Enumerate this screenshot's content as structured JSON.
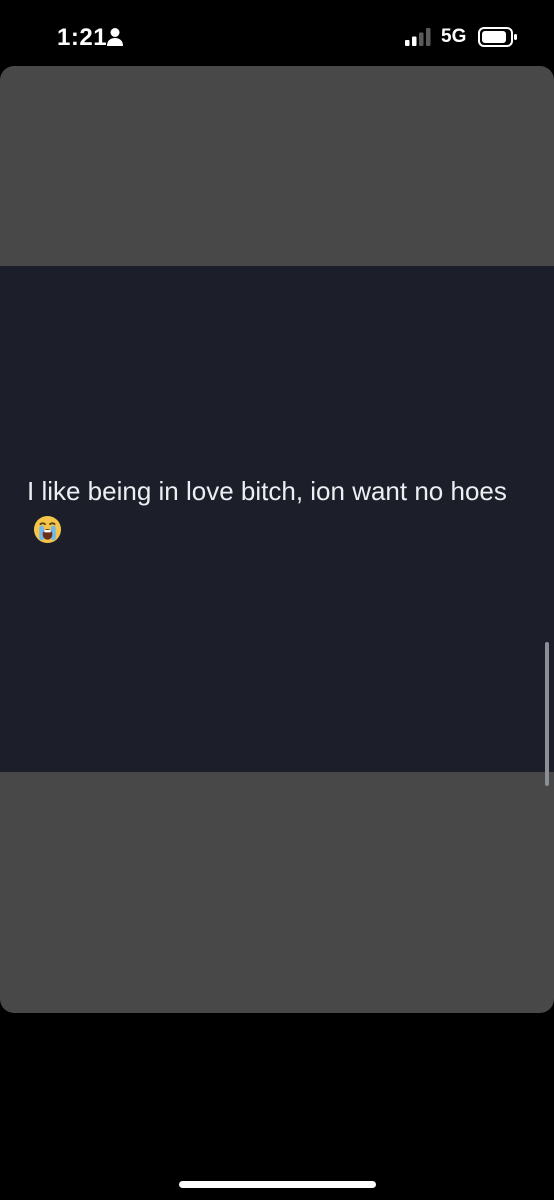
{
  "status_bar": {
    "time": "1:21",
    "network": "5G",
    "icons": {
      "person": "person-icon",
      "signal": "cellular-signal-icon",
      "battery": "battery-icon"
    }
  },
  "post": {
    "text": "I like being in love bitch, ion want no hoes",
    "emoji": "loudly-crying-face-icon"
  },
  "colors": {
    "screen_background": "#000000",
    "card_background": "#484848",
    "image_background": "#1c1f2a",
    "text": "#eceef2",
    "scroll_indicator": "#8c8f96"
  }
}
